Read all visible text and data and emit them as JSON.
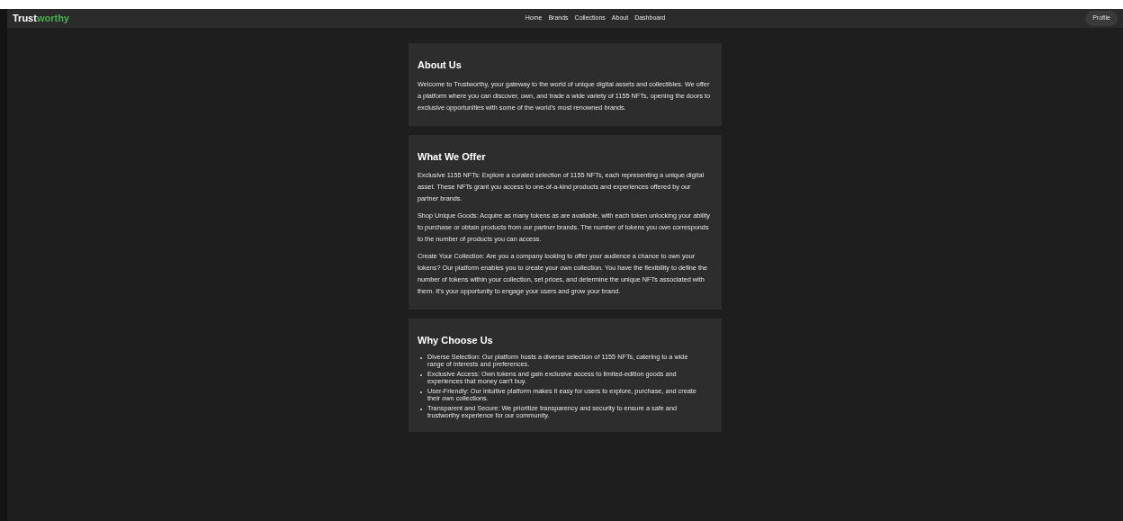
{
  "logo": {
    "part_1": "Trust",
    "part_2": "worthy"
  },
  "nav": [
    "Home",
    "Brands",
    "Collections",
    "About",
    "Dashboard"
  ],
  "profile_button": "Profile",
  "sections": [
    {
      "title": "About Us",
      "kind": "paragraphs",
      "items": [
        "Welcome to Trustworthy, your gateway to the world of unique digital assets and collectibles. We offer a platform where you can discover, own, and trade a wide variety of 1155 NFTs, opening the doors to exclusive opportunities with some of the world's most renowned brands."
      ]
    },
    {
      "title": "What We Offer",
      "kind": "paragraphs",
      "items": [
        "Exclusive 1155 NFTs: Explore a curated selection of 1155 NFTs, each representing a unique digital asset. These NFTs grant you access to one-of-a-kind products and experiences offered by our partner brands.",
        "Shop Unique Goods: Acquire as many tokens as are available, with each token unlocking your ability to purchase or obtain products from our partner brands. The number of tokens you own corresponds to the number of products you can access.",
        "Create Your Collection: Are you a company looking to offer your audience a chance to own your tokens? Our platform enables you to create your own collection. You have the flexibility to define the number of tokens within your collection, set prices, and determine the unique NFTs associated with them. It's your opportunity to engage your users and grow your brand."
      ]
    },
    {
      "title": "Why Choose Us",
      "kind": "bullets",
      "items": [
        "Diverse Selection: Our platform hosts a diverse selection of 1155 NFTs, catering to a wide range of interests and preferences.",
        "Exclusive Access: Own tokens and gain exclusive access to limited-edition goods and experiences that money can't buy.",
        "User-Friendly: Our intuitive platform makes it easy for users to explore, purchase, and create their own collections.",
        "Transparent and Secure: We prioritize transparency and security to ensure a safe and trustworthy experience for our community."
      ]
    }
  ]
}
